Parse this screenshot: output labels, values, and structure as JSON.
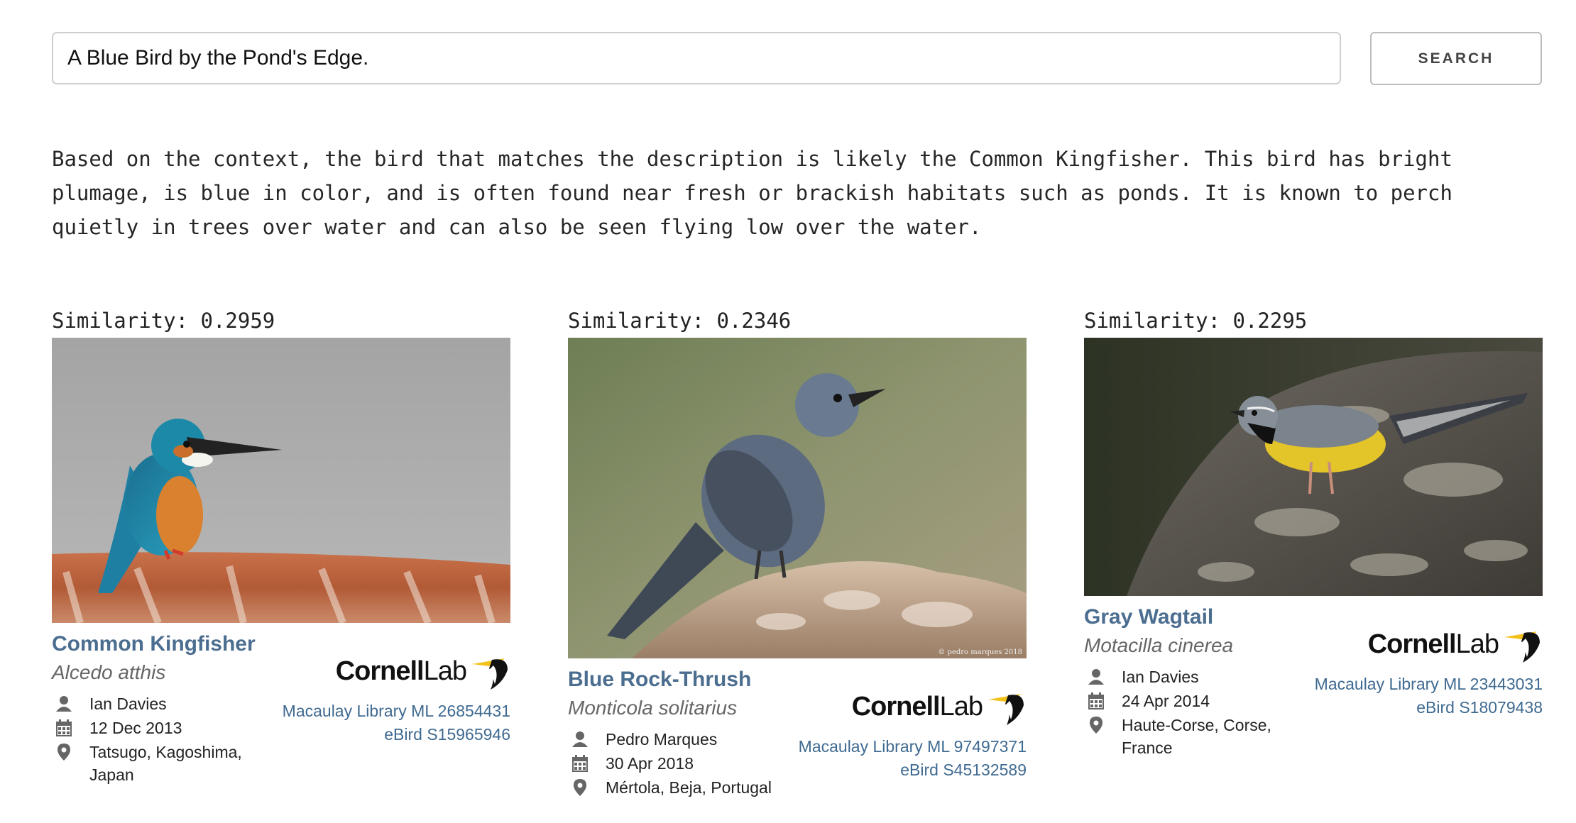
{
  "search": {
    "query": "A Blue Bird by the Pond's Edge.",
    "button_label": "SEARCH"
  },
  "answer_text": "Based on the context, the bird that matches the description is likely the Common Kingfisher. This bird has bright plumage, is blue in color, and is often found near fresh or brackish habitats such as ponds. It is known to perch quietly in trees over water and can also be seen flying low over the water.",
  "logo": {
    "part1": "Cornell",
    "part2": "Lab"
  },
  "results": [
    {
      "similarity": "Similarity: 0.2959",
      "common_name": "Common Kingfisher",
      "scientific_name": "Alcedo atthis",
      "photographer": "Ian Davies",
      "date": "12 Dec 2013",
      "location": "Tatsugo, Kagoshima, Japan",
      "macaulay": "Macaulay Library ML 26854431",
      "ebird": "eBird S15965946"
    },
    {
      "similarity": "Similarity: 0.2346",
      "common_name": "Blue Rock-Thrush",
      "scientific_name": "Monticola solitarius",
      "photographer": "Pedro Marques",
      "date": "30 Apr 2018",
      "location": "Mértola, Beja, Portugal",
      "macaulay": "Macaulay Library ML 97497371",
      "ebird": "eBird S45132589",
      "watermark": "© pedro marques 2018"
    },
    {
      "similarity": "Similarity: 0.2295",
      "common_name": "Gray Wagtail",
      "scientific_name": "Motacilla cinerea",
      "photographer": "Ian Davies",
      "date": "24 Apr 2014",
      "location": "Haute-Corse, Corse, France",
      "macaulay": "Macaulay Library ML 23443031",
      "ebird": "eBird S18079438"
    }
  ]
}
